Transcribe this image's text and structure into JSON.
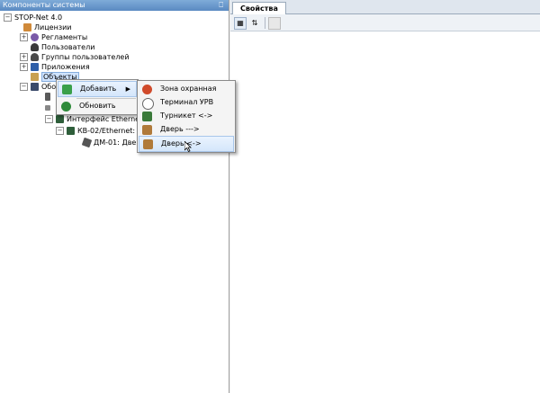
{
  "left_panel": {
    "title": "Компоненты системы",
    "pin_icon": "pin-icon"
  },
  "tree": {
    "root": "STOP-Net 4.0",
    "items": [
      {
        "label": "Лицензии"
      },
      {
        "label": "Регламенты"
      },
      {
        "label": "Пользователи"
      },
      {
        "label": "Группы пользователей"
      },
      {
        "label": "Приложения"
      },
      {
        "label": "Объекты"
      },
      {
        "label": "Обо"
      },
      {
        "label": "Интерфейс Ethernet"
      },
      {
        "label": "КВ-02/Ethernet:"
      },
      {
        "label": "ДМ-01: Двер"
      }
    ]
  },
  "context_menu": {
    "items": [
      {
        "label": "Добавить"
      },
      {
        "label": "Обновить"
      }
    ]
  },
  "submenu": {
    "items": [
      {
        "label": "Зона охранная"
      },
      {
        "label": "Терминал УРВ"
      },
      {
        "label": "Турникет <->"
      },
      {
        "label": "Дверь --->"
      },
      {
        "label": "Дверь <->"
      }
    ]
  },
  "properties": {
    "tab_label": "Свойства",
    "toolbar": {
      "categorized_icon": "categorized-icon",
      "sort_icon": "sort-az-icon",
      "pages_icon": "property-pages-icon"
    }
  },
  "colors": {
    "header": "#5a8ac2",
    "selection": "#cfe3ff",
    "menu_highlight": "#d4e6fb"
  }
}
